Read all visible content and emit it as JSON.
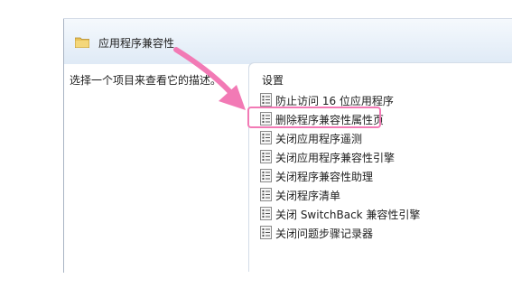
{
  "header": {
    "title": "应用程序兼容性",
    "icon": "folder-icon"
  },
  "left_pane": {
    "description": "选择一个项目来查看它的描述。"
  },
  "right_pane": {
    "column_header": "设置",
    "items": [
      {
        "label": "防止访问 16 位应用程序",
        "icon": "policy-document-icon"
      },
      {
        "label": "删除程序兼容性属性页",
        "icon": "policy-document-icon",
        "highlighted": true
      },
      {
        "label": "关闭应用程序遥测",
        "icon": "policy-document-icon"
      },
      {
        "label": "关闭应用程序兼容性引擎",
        "icon": "policy-document-icon"
      },
      {
        "label": "关闭程序兼容性助理",
        "icon": "policy-document-icon"
      },
      {
        "label": "关闭程序清单",
        "icon": "policy-document-icon"
      },
      {
        "label": "关闭 SwitchBack 兼容性引擎",
        "icon": "policy-document-icon"
      },
      {
        "label": "关闭问题步骤记录器",
        "icon": "policy-document-icon"
      }
    ]
  },
  "annotation": {
    "color": "#f27ab5",
    "arrow_icon": "pink-arrow-icon"
  }
}
